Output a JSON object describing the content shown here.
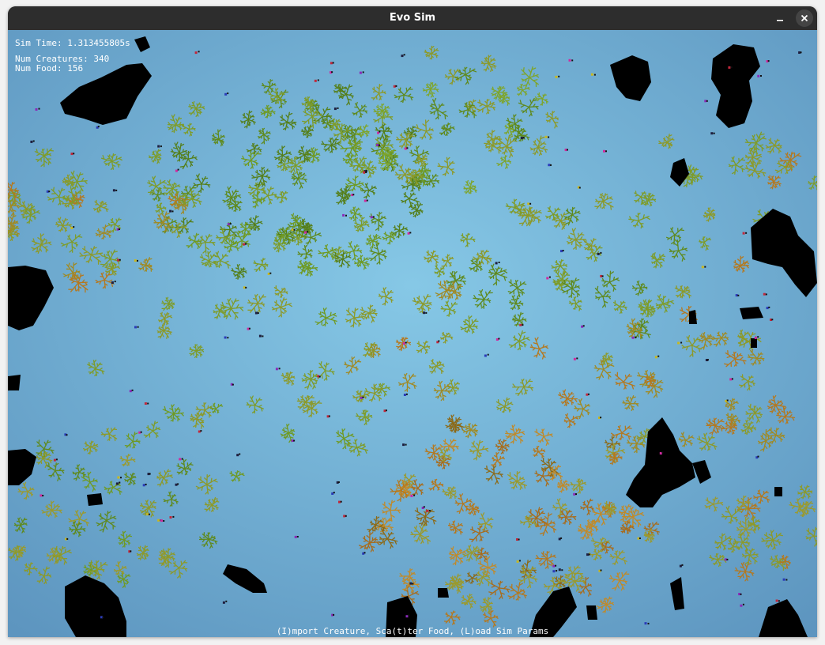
{
  "window": {
    "title": "Evo Sim",
    "minimize_icon": "minimize-icon",
    "close_icon": "close-icon"
  },
  "hud": {
    "sim_time": "Sim Time: 1.313455805s",
    "num_creatures": "Num Creatures: 340",
    "num_food": "Num Food: 156"
  },
  "help_text": "(I)mport Creature, Sca(t)ter Food, (L)oad Sim Params",
  "colors": {
    "background_center": "#86c8e6",
    "background_edge": "#5d95bf",
    "obstacle": "#000000",
    "food_green": "#5f8a1e",
    "food_olive": "#8c9a2a",
    "food_orange": "#b5781e",
    "creature_purple": "#8a2bb8",
    "creature_red": "#c0283c"
  }
}
